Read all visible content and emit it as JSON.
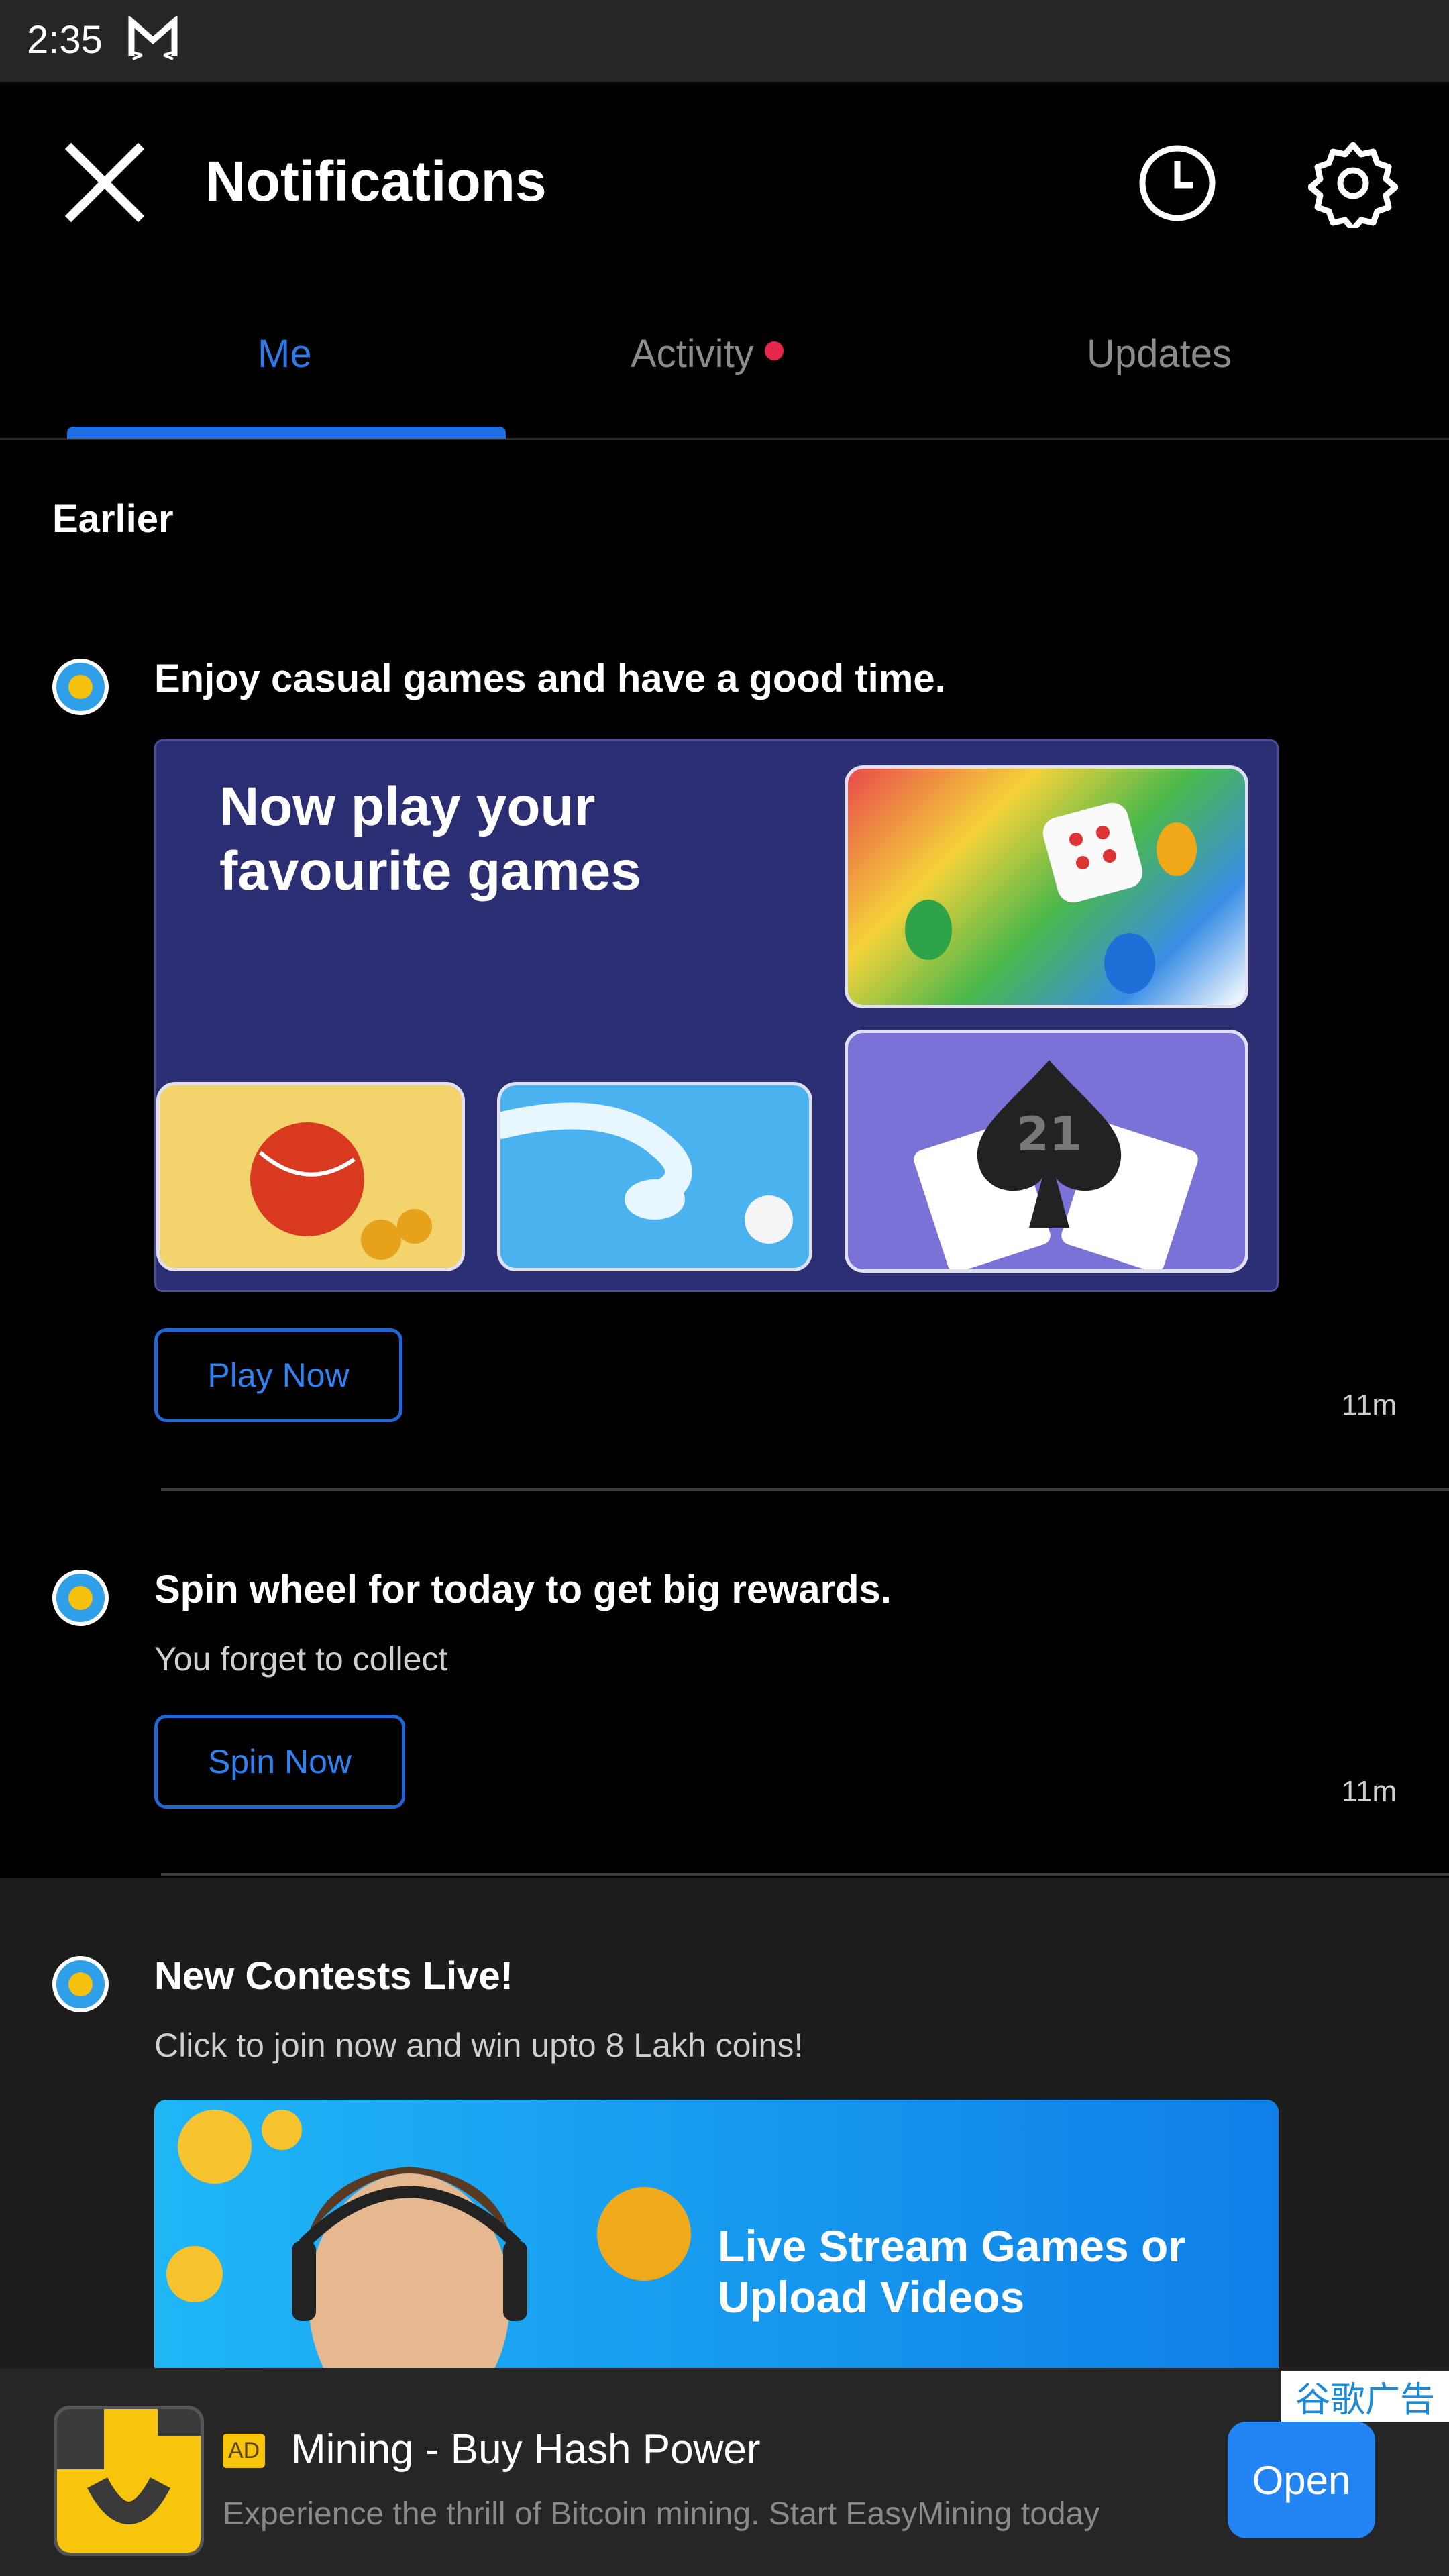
{
  "status_bar": {
    "time": "2:35"
  },
  "header": {
    "title": "Notifications"
  },
  "tabs": [
    {
      "label": "Me",
      "active": true
    },
    {
      "label": "Activity",
      "has_dot": true
    },
    {
      "label": "Updates"
    }
  ],
  "section": {
    "label": "Earlier"
  },
  "notifications": [
    {
      "title": "Enjoy casual games and have a good time.",
      "banner_text": "Now play your favourite games",
      "cta": "Play Now",
      "time": "11m"
    },
    {
      "title": "Spin wheel for today to get big rewards.",
      "subtitle": "You forget to collect",
      "cta": "Spin Now",
      "time": "11m"
    },
    {
      "title": "New Contests Live!",
      "subtitle": "Click to join now and win upto 8 Lakh coins!",
      "banner_text": "Live Stream Games or Upload Videos"
    }
  ],
  "ad": {
    "badge": "AD",
    "title": "Mining - Buy Hash Power",
    "description": "Experience the thrill of Bitcoin mining. Start EasyMining today",
    "open_label": "Open",
    "tag": "谷歌广告"
  },
  "colors": {
    "accent": "#1f6ee6",
    "dot": "#e5274a",
    "ad_open": "#2384f4"
  }
}
